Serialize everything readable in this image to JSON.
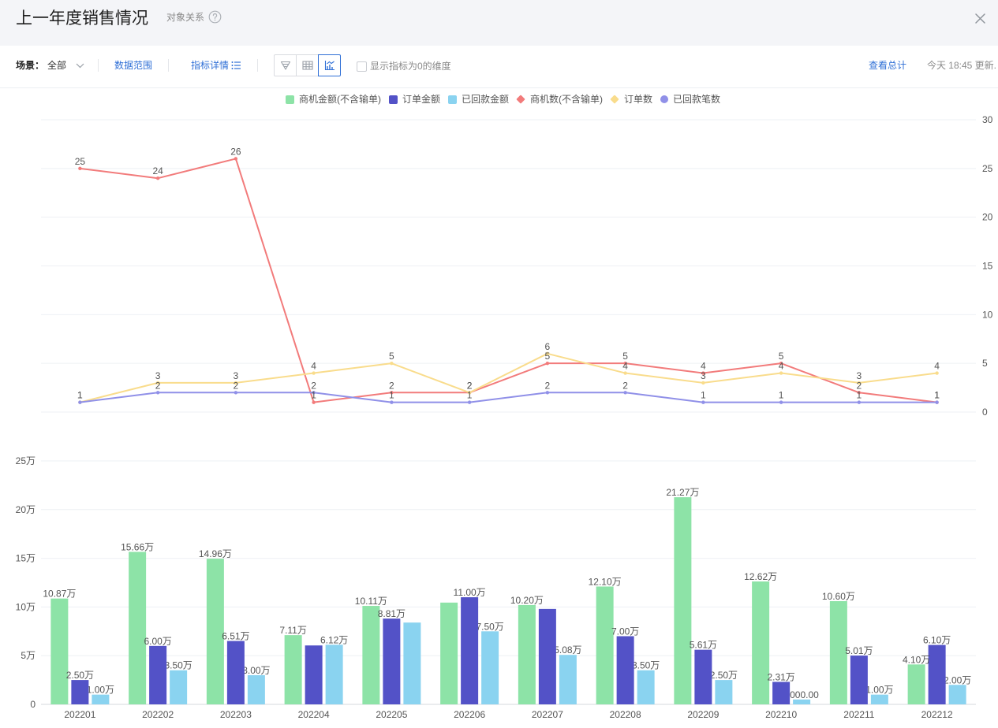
{
  "header": {
    "title": "上一年度销售情况",
    "relation_link": "对象关系",
    "help_icon": "help-circle-icon",
    "close_icon": "close-icon"
  },
  "toolbar": {
    "scene_label": "场景：",
    "scene_value": "全部",
    "data_range": "数据范围",
    "metric_details": "指标详情",
    "view_modes": [
      {
        "icon": "funnel-icon",
        "active": false
      },
      {
        "icon": "table-icon",
        "active": false
      },
      {
        "icon": "chart-icon",
        "active": true
      }
    ],
    "show_zero_label": "显示指标为0的维度",
    "show_zero_checked": false,
    "view_total": "查看总计",
    "update_time": "今天 18:45 更新."
  },
  "theme": {
    "accent": "#2f6fd6",
    "header_bg": "#f4f5f8"
  },
  "chart_data": [
    {
      "type": "line",
      "categories": [
        "202201",
        "202202",
        "202203",
        "202204",
        "202205",
        "202206",
        "202207",
        "202208",
        "202209",
        "202210",
        "202211",
        "202212"
      ],
      "y_axis": {
        "position": "right",
        "ticks": [
          "0",
          "5",
          "10",
          "15",
          "20",
          "25",
          "30"
        ],
        "ylim": [
          0,
          30
        ]
      },
      "grid": true,
      "data_labels": true,
      "series": [
        {
          "name": "商机数(不含输单)",
          "color": "#f27b7b",
          "icon": "diamond",
          "values": [
            25,
            24,
            26,
            1,
            2,
            2,
            5,
            5,
            4,
            5,
            2,
            1
          ]
        },
        {
          "name": "订单数",
          "color": "#f9dc8c",
          "icon": "diamond",
          "values": [
            1,
            3,
            3,
            4,
            5,
            2,
            6,
            4,
            3,
            4,
            3,
            4
          ]
        },
        {
          "name": "已回款笔数",
          "color": "#9090e8",
          "icon": "circle",
          "values": [
            1,
            2,
            2,
            2,
            1,
            1,
            2,
            2,
            1,
            1,
            1,
            1
          ]
        }
      ]
    },
    {
      "type": "bar",
      "categories": [
        "202201",
        "202202",
        "202203",
        "202204",
        "202205",
        "202206",
        "202207",
        "202208",
        "202209",
        "202210",
        "202211",
        "202212"
      ],
      "y_axis": {
        "position": "left",
        "ticks": [
          "0",
          "5万",
          "10万",
          "15万",
          "20万",
          "25万"
        ],
        "ylim": [
          0,
          25
        ],
        "unit": "万"
      },
      "grid": true,
      "legend_position": "top-center",
      "series": [
        {
          "name": "商机金额(不含输单)",
          "color": "#8de3a7",
          "icon": "rect",
          "values": [
            10.87,
            15.66,
            14.96,
            7.11,
            10.11,
            10.45,
            10.2,
            12.1,
            21.27,
            12.62,
            10.6,
            4.1
          ],
          "labels": [
            "10.87万",
            "15.66万",
            "14.96万",
            "7.11万",
            "10.11万",
            null,
            "10.20万",
            "12.10万",
            "21.27万",
            "12.62万",
            "10.60万",
            "4.10万"
          ]
        },
        {
          "name": "订单金额",
          "color": "#5352c7",
          "icon": "rect",
          "values": [
            2.5,
            6.0,
            6.51,
            6.05,
            8.81,
            11.0,
            9.8,
            7.0,
            5.61,
            2.31,
            5.01,
            6.1
          ],
          "labels": [
            "2.50万",
            "6.00万",
            "6.51万",
            null,
            "8.81万",
            "11.00万",
            null,
            "7.00万",
            "5.61万",
            "2.31万",
            "5.01万",
            "6.10万"
          ]
        },
        {
          "name": "已回款金额",
          "color": "#8ad3f0",
          "icon": "rect",
          "values": [
            1.0,
            3.5,
            3.0,
            6.12,
            8.4,
            7.5,
            5.08,
            3.5,
            2.5,
            0.5,
            1.0,
            2.0
          ],
          "labels": [
            "1.00万",
            "3.50万",
            "3.00万",
            "6.12万",
            null,
            "7.50万",
            "5.08万",
            "3.50万",
            "2.50万",
            "5000.00",
            "1.00万",
            "2.00万"
          ]
        }
      ]
    }
  ]
}
